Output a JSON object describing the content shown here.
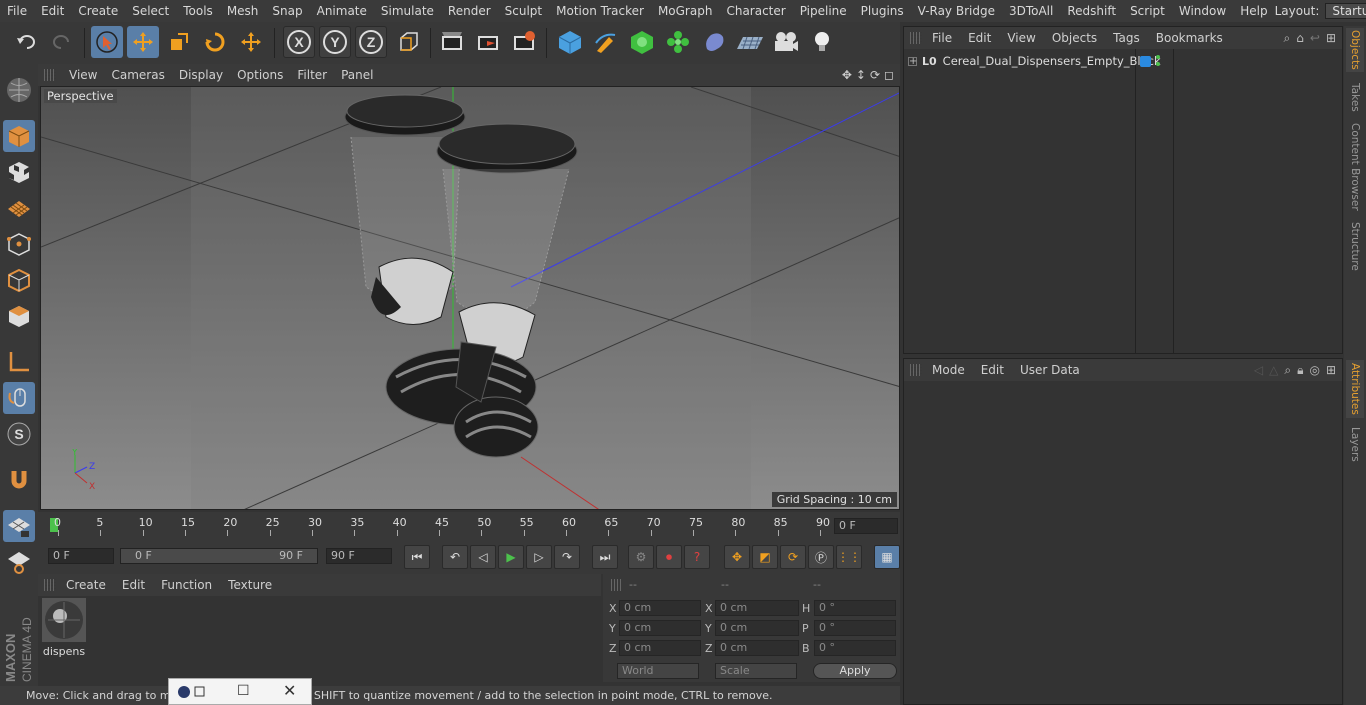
{
  "menubar": {
    "items": [
      "File",
      "Edit",
      "Create",
      "Select",
      "Tools",
      "Mesh",
      "Snap",
      "Animate",
      "Simulate",
      "Render",
      "Sculpt",
      "Motion Tracker",
      "MoGraph",
      "Character",
      "Pipeline",
      "Plugins",
      "V-Ray Bridge",
      "3DToAll",
      "Redshift",
      "Script",
      "Window",
      "Help"
    ],
    "layout_label": "Layout:",
    "layout_value": "Startup"
  },
  "viewport": {
    "menu": [
      "View",
      "Cameras",
      "Display",
      "Options",
      "Filter",
      "Panel"
    ],
    "camera_label": "Perspective",
    "grid_spacing": "Grid Spacing : 10 cm",
    "axis": {
      "x": "X",
      "y": "Y",
      "z": "Z"
    }
  },
  "timeline": {
    "ticks": [
      "0",
      "5",
      "10",
      "15",
      "20",
      "25",
      "30",
      "35",
      "40",
      "45",
      "50",
      "55",
      "60",
      "65",
      "70",
      "75",
      "80",
      "85",
      "90"
    ],
    "current_frame": "0 F"
  },
  "playbar": {
    "start": "0 F",
    "range_start": "0 F",
    "range_end": "90 F",
    "end": "90 F"
  },
  "material": {
    "menu": [
      "Create",
      "Edit",
      "Function",
      "Texture"
    ],
    "items": [
      {
        "name": "dispens"
      }
    ]
  },
  "coords": {
    "headers": [
      "--",
      "--",
      "--"
    ],
    "rows": [
      {
        "l1": "X",
        "v1": "0 cm",
        "l2": "X",
        "v2": "0 cm",
        "l3": "H",
        "v3": "0 °"
      },
      {
        "l1": "Y",
        "v1": "0 cm",
        "l2": "Y",
        "v2": "0 cm",
        "l3": "P",
        "v3": "0 °"
      },
      {
        "l1": "Z",
        "v1": "0 cm",
        "l2": "Z",
        "v2": "0 cm",
        "l3": "B",
        "v3": "0 °"
      }
    ],
    "mode_select": "World",
    "scale_select": "Scale",
    "apply": "Apply"
  },
  "status": {
    "text": "Move: Click and drag to move elements. Hold down SHIFT to quantize movement / add to the selection in point mode, CTRL to remove."
  },
  "objects": {
    "menu": [
      "File",
      "Edit",
      "View",
      "Objects",
      "Tags",
      "Bookmarks"
    ],
    "tree": [
      {
        "name": "Cereal_Dual_Dispensers_Empty_Black"
      }
    ]
  },
  "attributes": {
    "menu": [
      "Mode",
      "Edit",
      "User Data"
    ]
  },
  "right_tabs": [
    "Objects",
    "Takes",
    "Content Browser",
    "Structure",
    "Attributes",
    "Layers"
  ],
  "brand": {
    "maxon": "MAXON",
    "product": "CINEMA 4D"
  },
  "colors": {
    "accent": "#5a7fa8",
    "active_tab": "#e6a030",
    "playhead": "#4cc14c"
  }
}
